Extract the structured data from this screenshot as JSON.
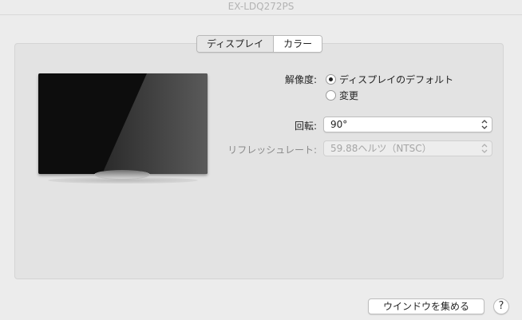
{
  "window": {
    "title": "EX-LDQ272PS"
  },
  "tabs": [
    {
      "label": "ディスプレイ",
      "active": true
    },
    {
      "label": "カラー",
      "active": false
    }
  ],
  "resolution": {
    "label": "解像度:",
    "options": [
      {
        "label": "ディスプレイのデフォルト",
        "selected": true
      },
      {
        "label": "変更",
        "selected": false
      }
    ]
  },
  "rotation": {
    "label": "回転:",
    "value": "90°"
  },
  "refresh": {
    "label": "リフレッシュレート:",
    "value": "59.88ヘルツ（NTSC）",
    "disabled": true
  },
  "footer": {
    "gather_label": "ウインドウを集める",
    "help_label": "?"
  }
}
